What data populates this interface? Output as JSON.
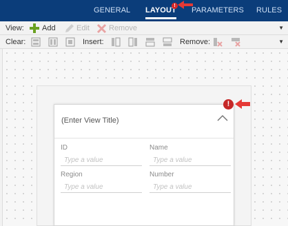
{
  "tabs": [
    {
      "label": "GENERAL",
      "active": false
    },
    {
      "label": "LAYOUT",
      "active": true,
      "badge": "!"
    },
    {
      "label": "PARAMETERS",
      "active": false
    },
    {
      "label": "RULES",
      "active": false
    }
  ],
  "toolbar_view": {
    "label": "View:",
    "add": "Add",
    "edit": "Edit",
    "remove": "Remove"
  },
  "toolbar_clear": {
    "clear_label": "Clear:",
    "insert_label": "Insert:",
    "remove_label": "Remove:"
  },
  "form": {
    "title": "(Enter View Title)",
    "warning": "!",
    "fields": [
      {
        "label": "ID",
        "placeholder": "Type a value"
      },
      {
        "label": "Name",
        "placeholder": "Type a value"
      },
      {
        "label": "Region",
        "placeholder": "Type a value"
      },
      {
        "label": "Number",
        "placeholder": "Type a value"
      }
    ]
  },
  "colors": {
    "tabbar": "#0b3d7a",
    "warning": "#c62828",
    "callout_arrow": "#e53935",
    "add_icon": "#6aa121"
  }
}
